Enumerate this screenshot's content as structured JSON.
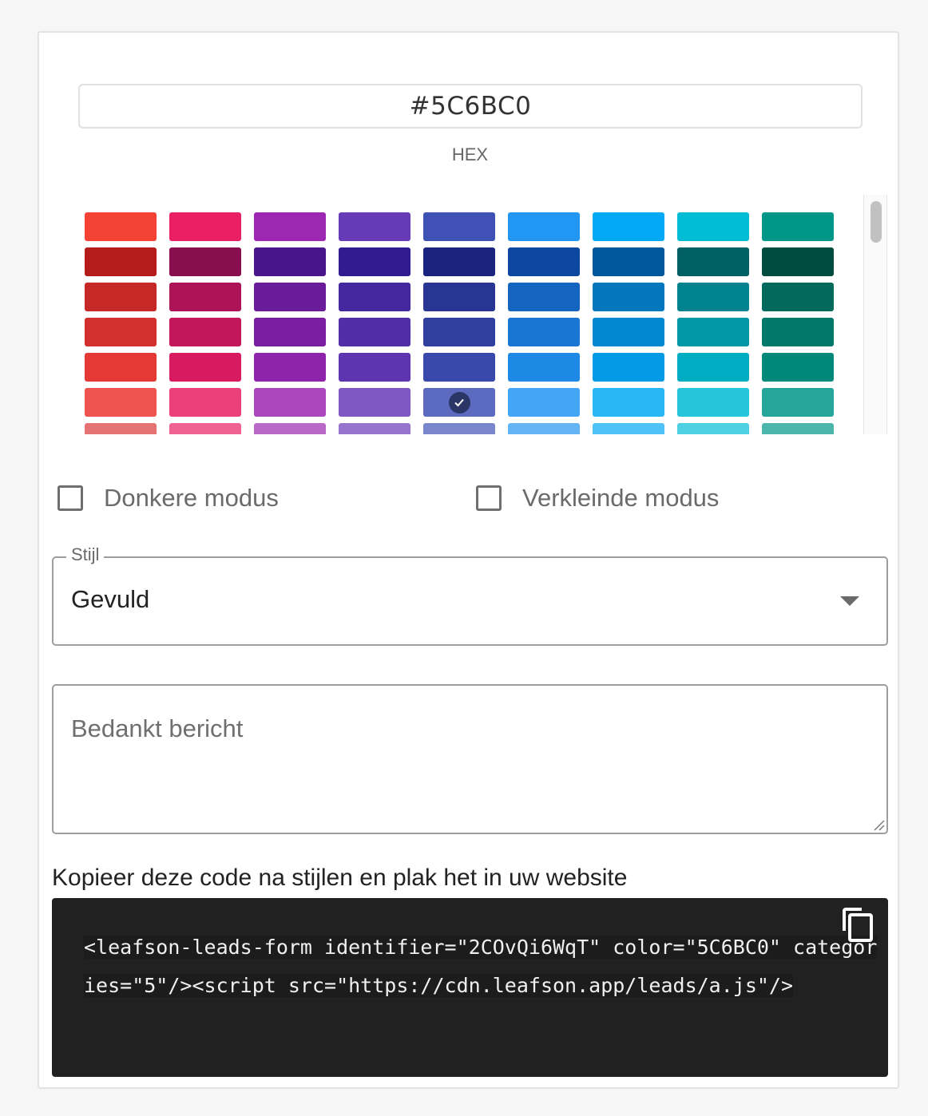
{
  "color_picker": {
    "hex_value": "#5C6BC0",
    "hex_label": "HEX",
    "selected_swatch": "#5C6BC0",
    "palette_rows": [
      [
        "#F44336",
        "#E91E63",
        "#9C27B0",
        "#673AB7",
        "#3F51B5",
        "#2196F3",
        "#03A9F4",
        "#00BCD4",
        "#009688"
      ],
      [
        "#B71C1C",
        "#880E4F",
        "#4A148C",
        "#311B92",
        "#1A237E",
        "#0D47A1",
        "#01579B",
        "#006064",
        "#004D40"
      ],
      [
        "#C62828",
        "#AD1457",
        "#6A1B9A",
        "#4527A0",
        "#283593",
        "#1565C0",
        "#0277BD",
        "#00838F",
        "#00695C"
      ],
      [
        "#D32F2F",
        "#C2185B",
        "#7B1FA2",
        "#512DA8",
        "#303F9F",
        "#1976D2",
        "#0288D1",
        "#0097A7",
        "#00796B"
      ],
      [
        "#E53935",
        "#D81B60",
        "#8E24AA",
        "#5E35B1",
        "#3949AB",
        "#1E88E5",
        "#039BE5",
        "#00ACC1",
        "#00897B"
      ],
      [
        "#EF5350",
        "#EC407A",
        "#AB47BC",
        "#7E57C2",
        "#5C6BC0",
        "#42A5F5",
        "#29B6F6",
        "#26C6DA",
        "#26A69A"
      ],
      [
        "#E57373",
        "#F06292",
        "#BA68C8",
        "#9575CD",
        "#7986CB",
        "#64B5F6",
        "#4FC3F7",
        "#4DD0E1",
        "#4DB6AC"
      ]
    ]
  },
  "options": {
    "dark_mode_label": "Donkere modus",
    "dark_mode_checked": false,
    "compact_mode_label": "Verkleinde modus",
    "compact_mode_checked": false
  },
  "style_select": {
    "label": "Stijl",
    "value": "Gevuld"
  },
  "thanks_message": {
    "placeholder": "Bedankt bericht",
    "value": ""
  },
  "embed": {
    "heading": "Kopieer deze code na stijlen en plak het in uw website",
    "code": "<leafson-leads-form identifier=\"2COvQi6WqT\" color=\"5C6BC0\" categories=\"5\"/><script src=\"https://cdn.leafson.app/leads/a.js\"/>"
  },
  "icons": {
    "copy": "copy-icon",
    "check": "check-icon",
    "dropdown": "triangle-down-icon",
    "resize": "resize-handle-icon"
  }
}
